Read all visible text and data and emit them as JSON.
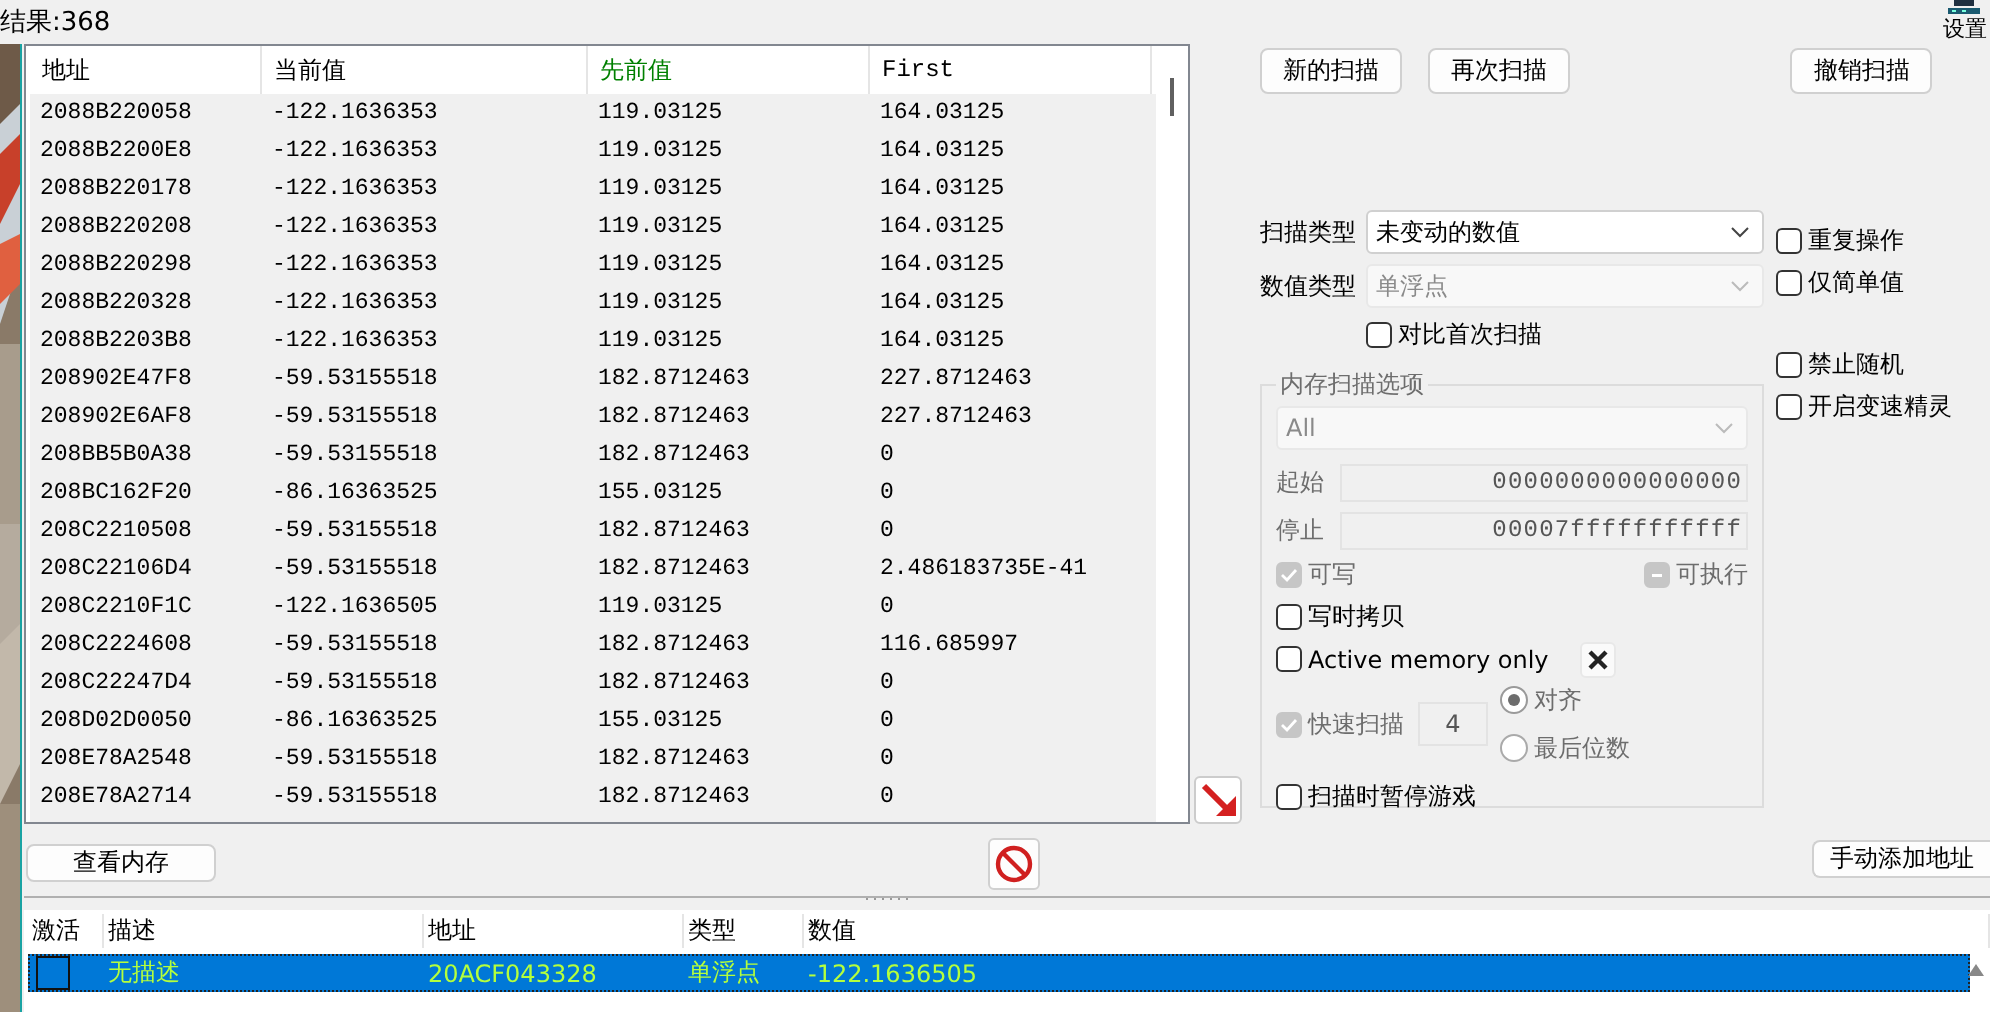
{
  "results_label": "结果:368",
  "settings": {
    "label": "设置"
  },
  "results_table": {
    "columns": [
      {
        "label": "地址",
        "color": "#000000"
      },
      {
        "label": "当前值",
        "color": "#000000"
      },
      {
        "label": "先前值",
        "color": "#008000"
      },
      {
        "label": "First",
        "color": "#000000"
      }
    ],
    "rows": [
      [
        "2088B220058",
        "-122.1636353",
        "119.03125",
        "164.03125"
      ],
      [
        "2088B2200E8",
        "-122.1636353",
        "119.03125",
        "164.03125"
      ],
      [
        "2088B220178",
        "-122.1636353",
        "119.03125",
        "164.03125"
      ],
      [
        "2088B220208",
        "-122.1636353",
        "119.03125",
        "164.03125"
      ],
      [
        "2088B220298",
        "-122.1636353",
        "119.03125",
        "164.03125"
      ],
      [
        "2088B220328",
        "-122.1636353",
        "119.03125",
        "164.03125"
      ],
      [
        "2088B2203B8",
        "-122.1636353",
        "119.03125",
        "164.03125"
      ],
      [
        "208902E47F8",
        "-59.53155518",
        "182.8712463",
        "227.8712463"
      ],
      [
        "208902E6AF8",
        "-59.53155518",
        "182.8712463",
        "227.8712463"
      ],
      [
        "208BB5B0A38",
        "-59.53155518",
        "182.8712463",
        "0"
      ],
      [
        "208BC162F20",
        "-86.16363525",
        "155.03125",
        "0"
      ],
      [
        "208C2210508",
        "-59.53155518",
        "182.8712463",
        "0"
      ],
      [
        "208C22106D4",
        "-59.53155518",
        "182.8712463",
        "2.486183735E-41"
      ],
      [
        "208C2210F1C",
        "-122.1636505",
        "119.03125",
        "0"
      ],
      [
        "208C2224608",
        "-59.53155518",
        "182.8712463",
        "116.685997"
      ],
      [
        "208C22247D4",
        "-59.53155518",
        "182.8712463",
        "0"
      ],
      [
        "208D02D0050",
        "-86.16363525",
        "155.03125",
        "0"
      ],
      [
        "208E78A2548",
        "-59.53155518",
        "182.8712463",
        "0"
      ],
      [
        "208E78A2714",
        "-59.53155518",
        "182.8712463",
        "0"
      ]
    ]
  },
  "scan_buttons": [
    {
      "label": "新的扫描"
    },
    {
      "label": "再次扫描"
    },
    {
      "label": "撤销扫描"
    }
  ],
  "scan_type": {
    "label": "扫描类型",
    "value": "未变动的数值",
    "disabled": false
  },
  "value_type": {
    "label": "数值类型",
    "value": "单浮点",
    "disabled": true
  },
  "compare_first": {
    "label": "对比首次扫描",
    "checked": false
  },
  "side_options": [
    {
      "label": "重复操作",
      "checked": false
    },
    {
      "label": "仅简单值",
      "checked": false
    },
    {
      "label": "禁止随机",
      "checked": false
    },
    {
      "label": "开启变速精灵",
      "checked": false
    }
  ],
  "memory_options": {
    "title": "内存扫描选项",
    "region": {
      "value": "All",
      "disabled": true
    },
    "start": {
      "label": "起始",
      "value": "0000000000000000"
    },
    "stop": {
      "label": "停止",
      "value": "00007fffffffffff"
    },
    "writable": {
      "label": "可写",
      "checked": true,
      "disabled": true
    },
    "executable": {
      "label": "可执行",
      "checked": false,
      "indeterminate": true,
      "disabled": true
    },
    "copy_on_write": {
      "label": "写时拷贝",
      "checked": false
    },
    "active_memory": {
      "label": "Active memory only",
      "checked": false
    },
    "fast_scan": {
      "label": "快速扫描",
      "checked": true,
      "disabled": true,
      "value": "4"
    },
    "alignment": [
      {
        "label": "对齐",
        "selected": true
      },
      {
        "label": "最后位数",
        "selected": false
      }
    ],
    "pause_game": {
      "label": "扫描时暂停游戏",
      "checked": false
    }
  },
  "view_memory_button": {
    "label": "查看内存"
  },
  "add_address_button": {
    "label": "手动添加地址"
  },
  "address_list": {
    "columns": [
      "激活",
      "描述",
      "地址",
      "类型",
      "数值"
    ],
    "rows": [
      {
        "active": false,
        "selected": true,
        "description": "无描述",
        "address": "20ACF043328",
        "type": "单浮点",
        "value": "-122.1636505"
      }
    ]
  }
}
